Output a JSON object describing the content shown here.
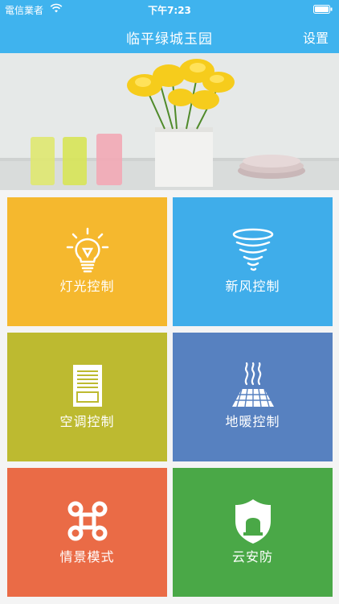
{
  "status_bar": {
    "carrier": "電信業者",
    "time": "下午7:23"
  },
  "nav": {
    "title": "临平绿城玉园",
    "settings_label": "设置"
  },
  "tiles": [
    {
      "label": "灯光控制",
      "icon": "lightbulb-icon",
      "color": "#f5b82e"
    },
    {
      "label": "新风控制",
      "icon": "fresh-air-tornado-icon",
      "color": "#3fadea"
    },
    {
      "label": "空调控制",
      "icon": "air-conditioner-icon",
      "color": "#bdba30"
    },
    {
      "label": "地暖控制",
      "icon": "floor-heating-icon",
      "color": "#5781c0"
    },
    {
      "label": "情景模式",
      "icon": "command-scene-icon",
      "color": "#ea6b46"
    },
    {
      "label": "云安防",
      "icon": "security-shield-icon",
      "color": "#4aa847"
    }
  ],
  "colors": {
    "header": "#3fb3ee"
  }
}
